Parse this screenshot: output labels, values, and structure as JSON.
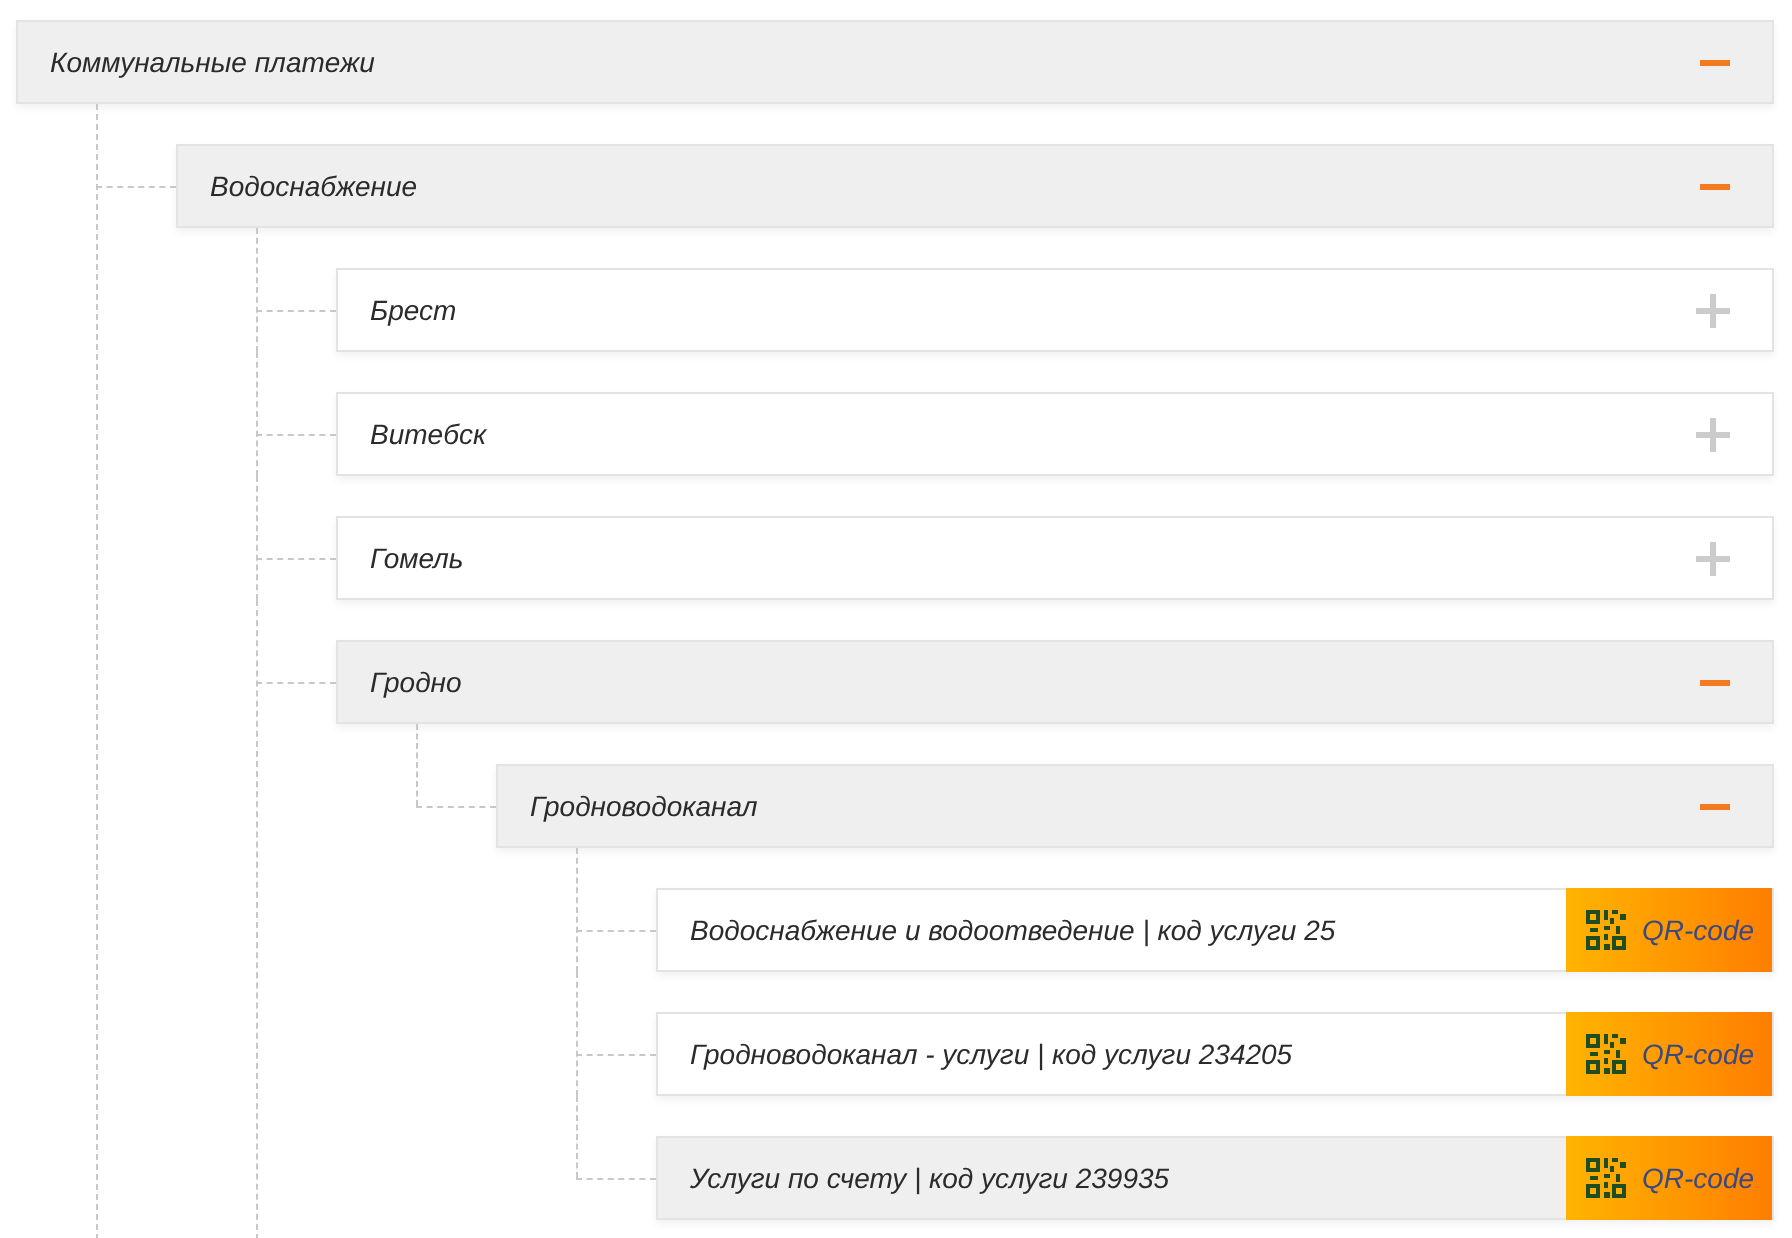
{
  "tree": [
    {
      "kind": "group",
      "label": "Коммунальные платежи",
      "expanded": true,
      "continues_below": true,
      "children": [
        {
          "kind": "group",
          "label": "Водоснабжение",
          "expanded": true,
          "continues_below": true,
          "children": [
            {
              "kind": "group",
              "label": "Брест",
              "expanded": false
            },
            {
              "kind": "group",
              "label": "Витебск",
              "expanded": false
            },
            {
              "kind": "group",
              "label": "Гомель",
              "expanded": false
            },
            {
              "kind": "group",
              "label": "Гродно",
              "expanded": true,
              "continues_below": false,
              "children": [
                {
                  "kind": "group",
                  "label": "Гродноводоканал",
                  "expanded": true,
                  "continues_below": false,
                  "children": [
                    {
                      "kind": "service",
                      "label": "Водоснабжение и водоотведение | код услуги 25",
                      "button": "QR-code",
                      "selected": false
                    },
                    {
                      "kind": "service",
                      "label": "Гродноводоканал - услуги | код услуги 234205",
                      "button": "QR-code",
                      "selected": false
                    },
                    {
                      "kind": "service",
                      "label": "Услуги по счету | код услуги 239935",
                      "button": "QR-code",
                      "selected": true
                    }
                  ]
                }
              ]
            }
          ]
        }
      ]
    }
  ]
}
